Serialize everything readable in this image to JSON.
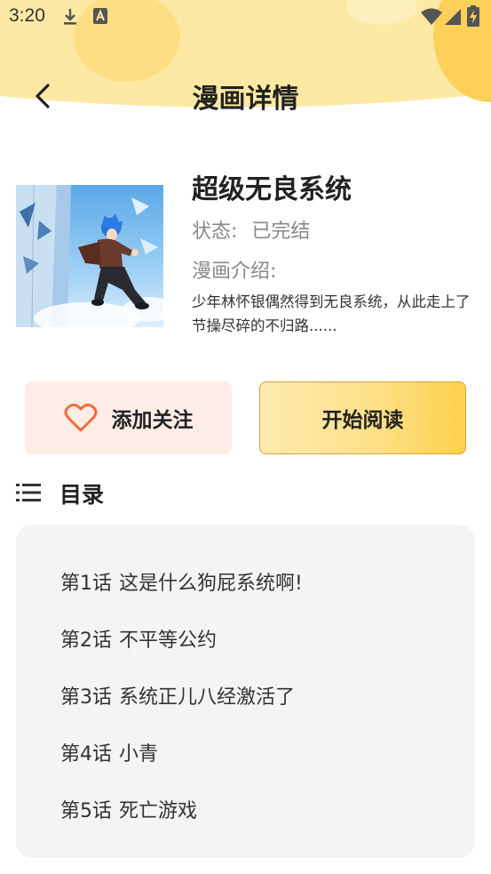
{
  "status_bar": {
    "time": "3:20",
    "icons": [
      "download-icon",
      "notification-a-icon",
      "wifi-icon",
      "signal-icon",
      "battery-charging-icon"
    ]
  },
  "header": {
    "title": "漫画详情",
    "back_icon": "chevron-left-icon"
  },
  "comic": {
    "title": "超级无良系统",
    "status_label": "状态:",
    "status_value": "已完结",
    "intro_label": "漫画介绍:",
    "intro_text": "少年林怀银偶然得到无良系统，从此走上了节操尽碎的不归路......"
  },
  "actions": {
    "follow_label": "添加关注",
    "read_label": "开始阅读"
  },
  "catalog": {
    "title": "目录",
    "chapters": [
      {
        "num": "第1话",
        "name": "这是什么狗屁系统啊!"
      },
      {
        "num": "第2话",
        "name": "不平等公约"
      },
      {
        "num": "第3话",
        "name": "系统正儿八经激活了"
      },
      {
        "num": "第4话",
        "name": "小青"
      },
      {
        "num": "第5话",
        "name": "死亡游戏"
      }
    ]
  },
  "colors": {
    "header_yellow": "#fde9a3",
    "accent_yellow": "#fdd14a",
    "follow_bg": "#feede6",
    "heart": "#f26b3a",
    "panel_bg": "#f4f4f4"
  }
}
